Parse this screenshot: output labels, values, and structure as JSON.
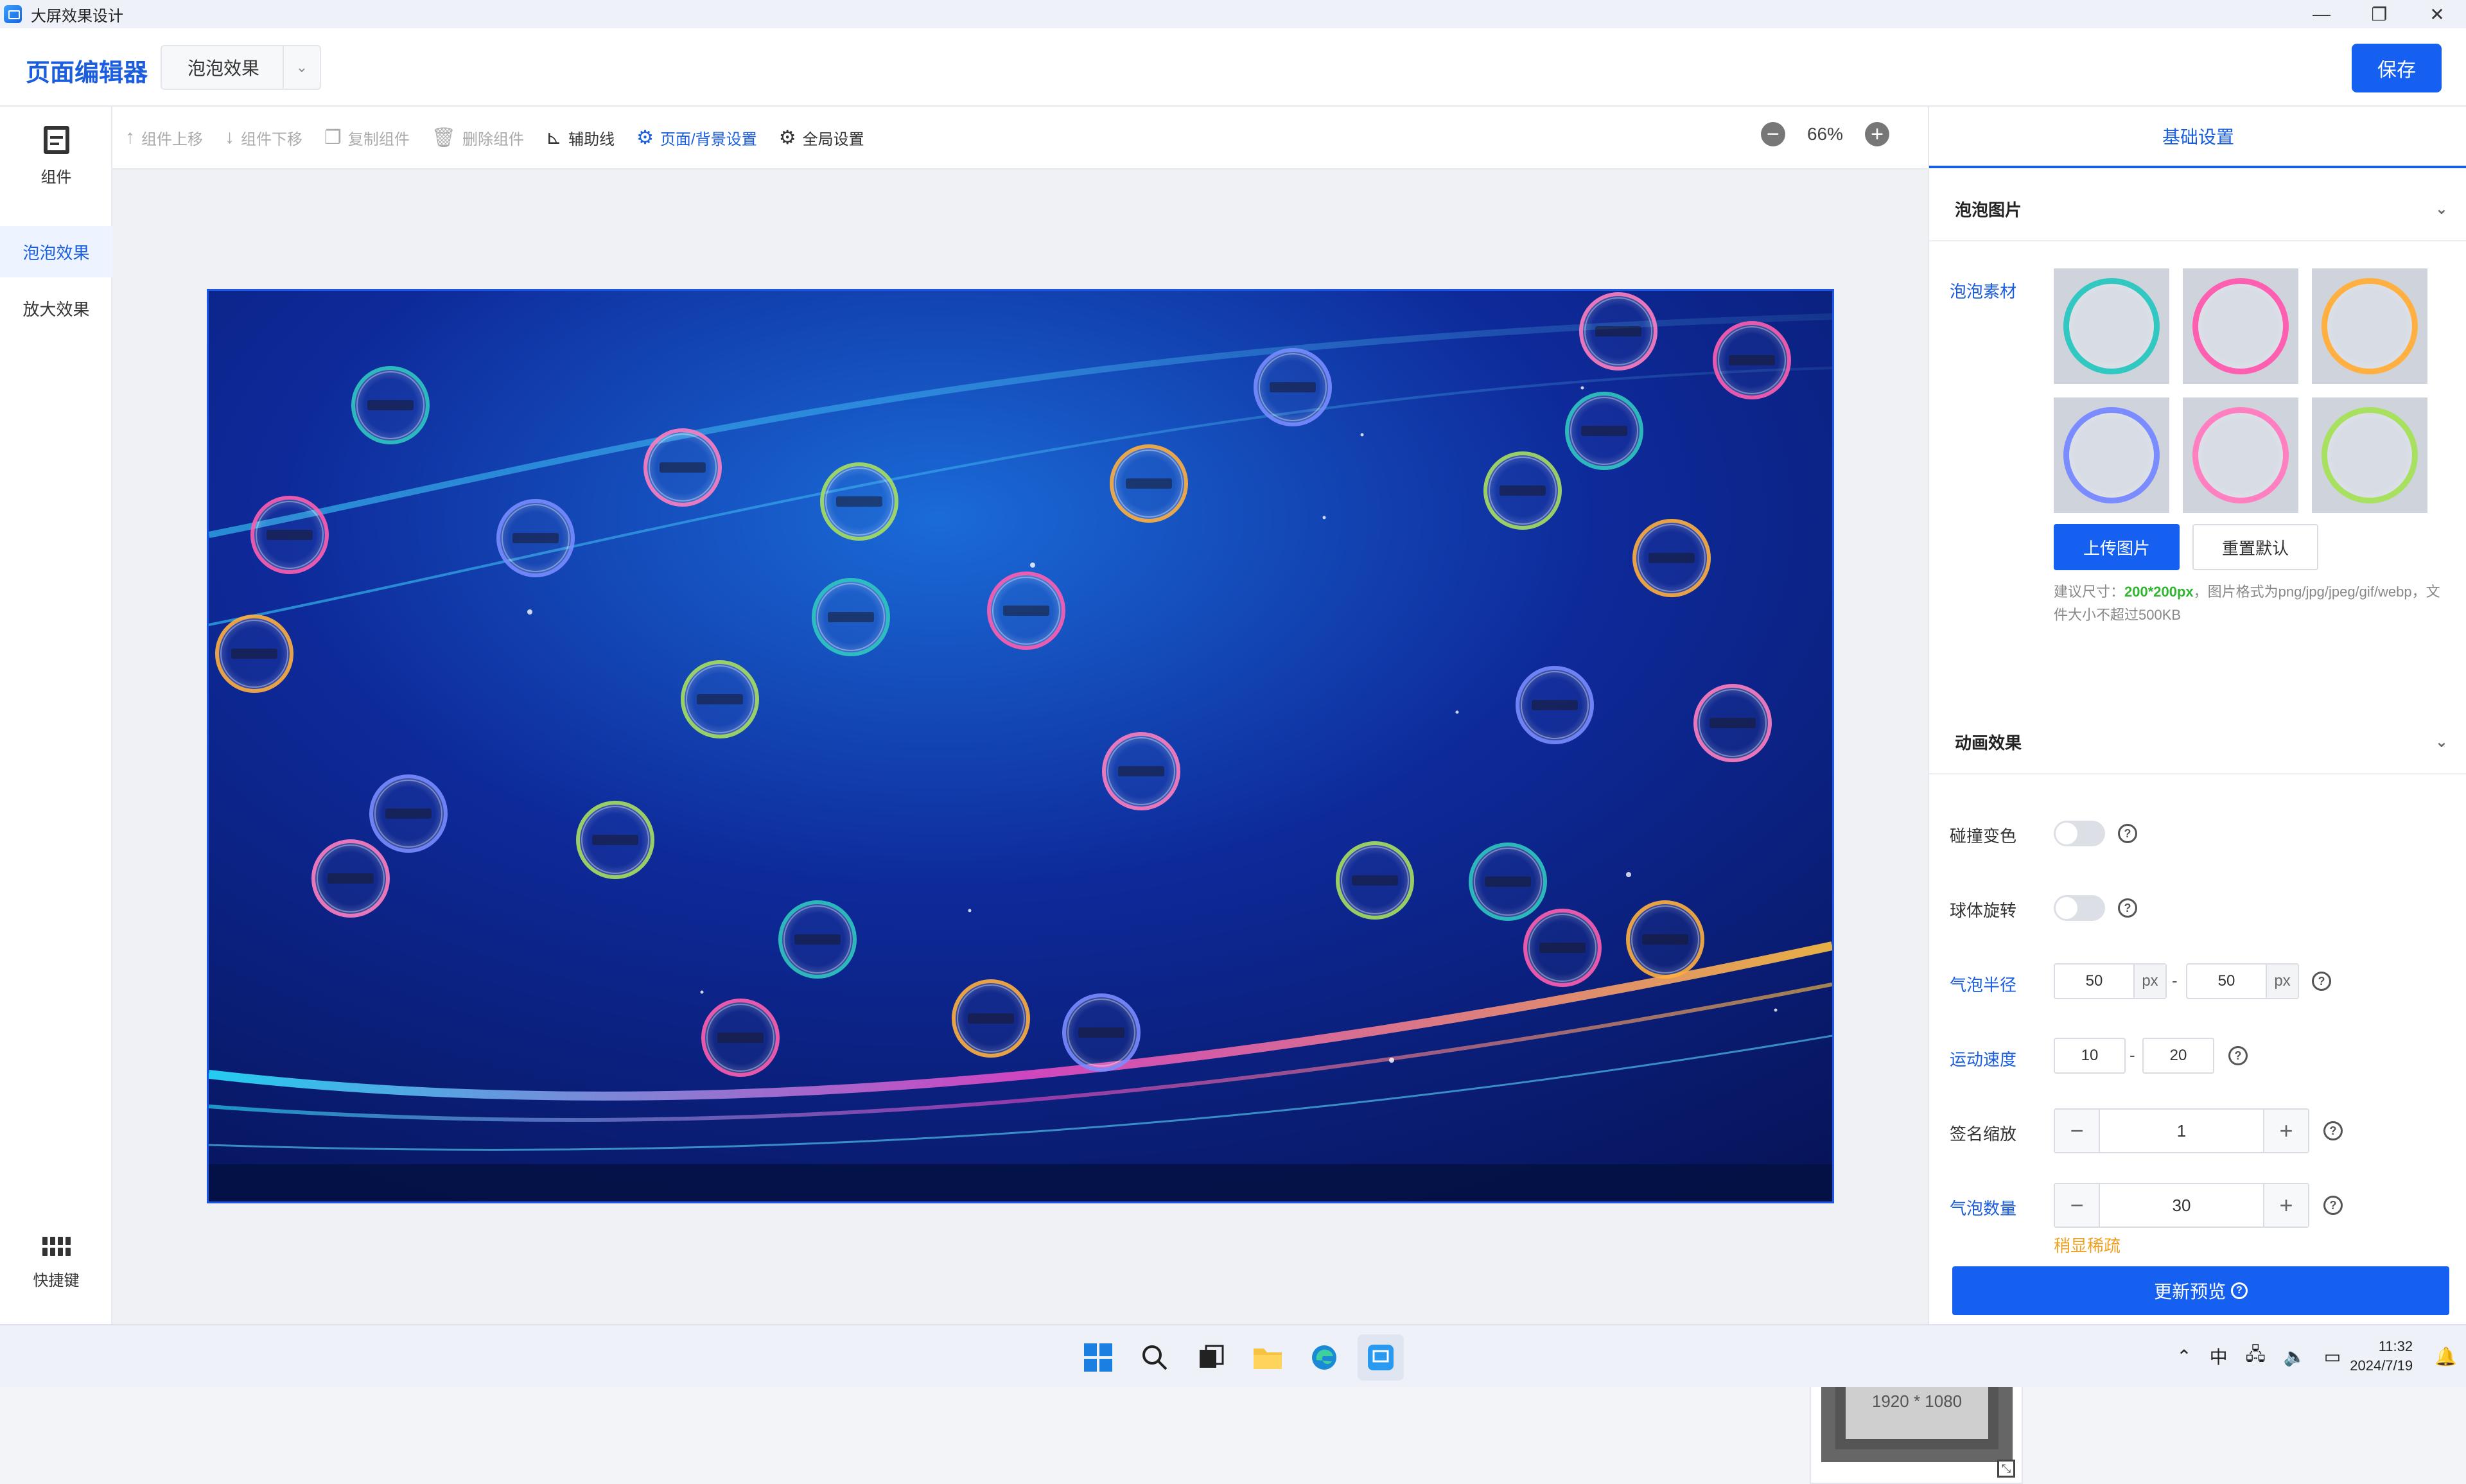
{
  "window": {
    "title": "大屏效果设计",
    "controls": [
      "—",
      "❐",
      "✕"
    ]
  },
  "header": {
    "brand": "页面编辑器",
    "page_select": "泡泡效果",
    "save_label": "保存"
  },
  "leftnav": {
    "components_label": "组件",
    "items": [
      {
        "label": "泡泡效果",
        "active": true
      },
      {
        "label": "放大效果",
        "active": false
      }
    ],
    "shortcut_label": "快捷键"
  },
  "toolbar": {
    "items": [
      {
        "label": "组件上移",
        "icon": "arrow-up-icon",
        "glyph": "↑",
        "state": "disabled"
      },
      {
        "label": "组件下移",
        "icon": "arrow-down-icon",
        "glyph": "↓",
        "state": "disabled"
      },
      {
        "label": "复制组件",
        "icon": "copy-icon",
        "glyph": "❐",
        "state": "disabled"
      },
      {
        "label": "删除组件",
        "icon": "trash-icon",
        "glyph": "🗑",
        "state": "disabled"
      },
      {
        "label": "辅助线",
        "icon": "guide-line-icon",
        "glyph": "⊾",
        "state": "enabled"
      },
      {
        "label": "页面/背景设置",
        "icon": "gear-icon",
        "glyph": "⚙",
        "state": "active"
      },
      {
        "label": "全局设置",
        "icon": "gear-icon",
        "glyph": "⚙",
        "state": "enabled"
      }
    ],
    "zoom": "66%"
  },
  "minimap": {
    "size_label": "1920 * 1080"
  },
  "panel": {
    "tab": "基础设置",
    "bubble_image": {
      "title": "泡泡图片",
      "material_label": "泡泡素材",
      "thumb_colors": [
        "#30c8c0",
        "#ff5fb0",
        "#ffb040",
        "#7a8cff",
        "#ff7fc0",
        "#a8e060"
      ],
      "upload_label": "上传图片",
      "reset_label": "重置默认",
      "hint_prefix": "建议尺寸：",
      "hint_size": "200*200px",
      "hint_rest": "，图片格式为png/jpg/jpeg/gif/webp，文件大小不超过500KB"
    },
    "animation": {
      "title": "动画效果",
      "collision_color_label": "碰撞变色",
      "sphere_rotate_label": "球体旋转",
      "radius_label": "气泡半径",
      "radius_min": "50",
      "radius_max": "50",
      "unit": "px",
      "speed_label": "运动速度",
      "speed_min": "10",
      "speed_max": "20",
      "sign_scale_label": "签名缩放",
      "sign_scale": "1",
      "count_label": "气泡数量",
      "count": "30",
      "warning": "稍显稀疏",
      "range_sep": "-",
      "help_glyph": "?",
      "minus": "−",
      "plus": "+",
      "update_label": "更新预览"
    }
  },
  "taskbar": {
    "tray_ime": "中",
    "time": "11:32",
    "date": "2024/7/19"
  }
}
